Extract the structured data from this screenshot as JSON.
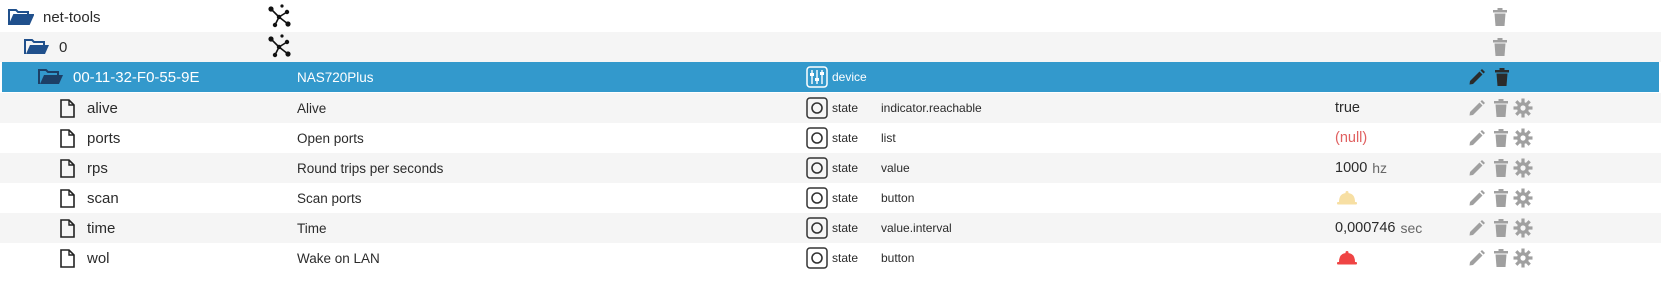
{
  "rows": [
    {
      "id": "net-tools",
      "type": "folder-open",
      "level": 0
    },
    {
      "id": "0",
      "type": "folder-open",
      "level": 1
    },
    {
      "id": "00-11-32-F0-55-9E",
      "name": "NAS720Plus",
      "obj_type": "device",
      "selected": true
    },
    {
      "id": "alive",
      "name": "Alive",
      "obj_type": "state",
      "role": "indicator.reachable",
      "value": "true"
    },
    {
      "id": "ports",
      "name": "Open ports",
      "obj_type": "state",
      "role": "list",
      "value": "(null)"
    },
    {
      "id": "rps",
      "name": "Round trips per seconds",
      "obj_type": "state",
      "role": "value",
      "value": "1000",
      "unit": "hz"
    },
    {
      "id": "scan",
      "name": "Scan ports",
      "obj_type": "state",
      "role": "button",
      "value_icon": "bell-icon",
      "value_color": "#f7dfa3"
    },
    {
      "id": "time",
      "name": "Time",
      "obj_type": "state",
      "role": "value.interval",
      "value": "0,000746",
      "unit": "sec"
    },
    {
      "id": "wol",
      "name": "Wake on LAN",
      "obj_type": "state",
      "role": "button",
      "value_icon": "bell-icon",
      "value_color": "#ef4444"
    }
  ],
  "colors": {
    "selected_bg": "#3399cc",
    "null_text": "#e06060",
    "action_icon": "#a0a0a0"
  },
  "icons": {
    "adapter": "network-adapter-icon",
    "device": "device-icon",
    "state": "state-icon",
    "folder": "folder-open-icon",
    "file": "file-icon",
    "edit": "pencil-icon",
    "delete": "trash-icon",
    "settings": "gear-icon"
  }
}
